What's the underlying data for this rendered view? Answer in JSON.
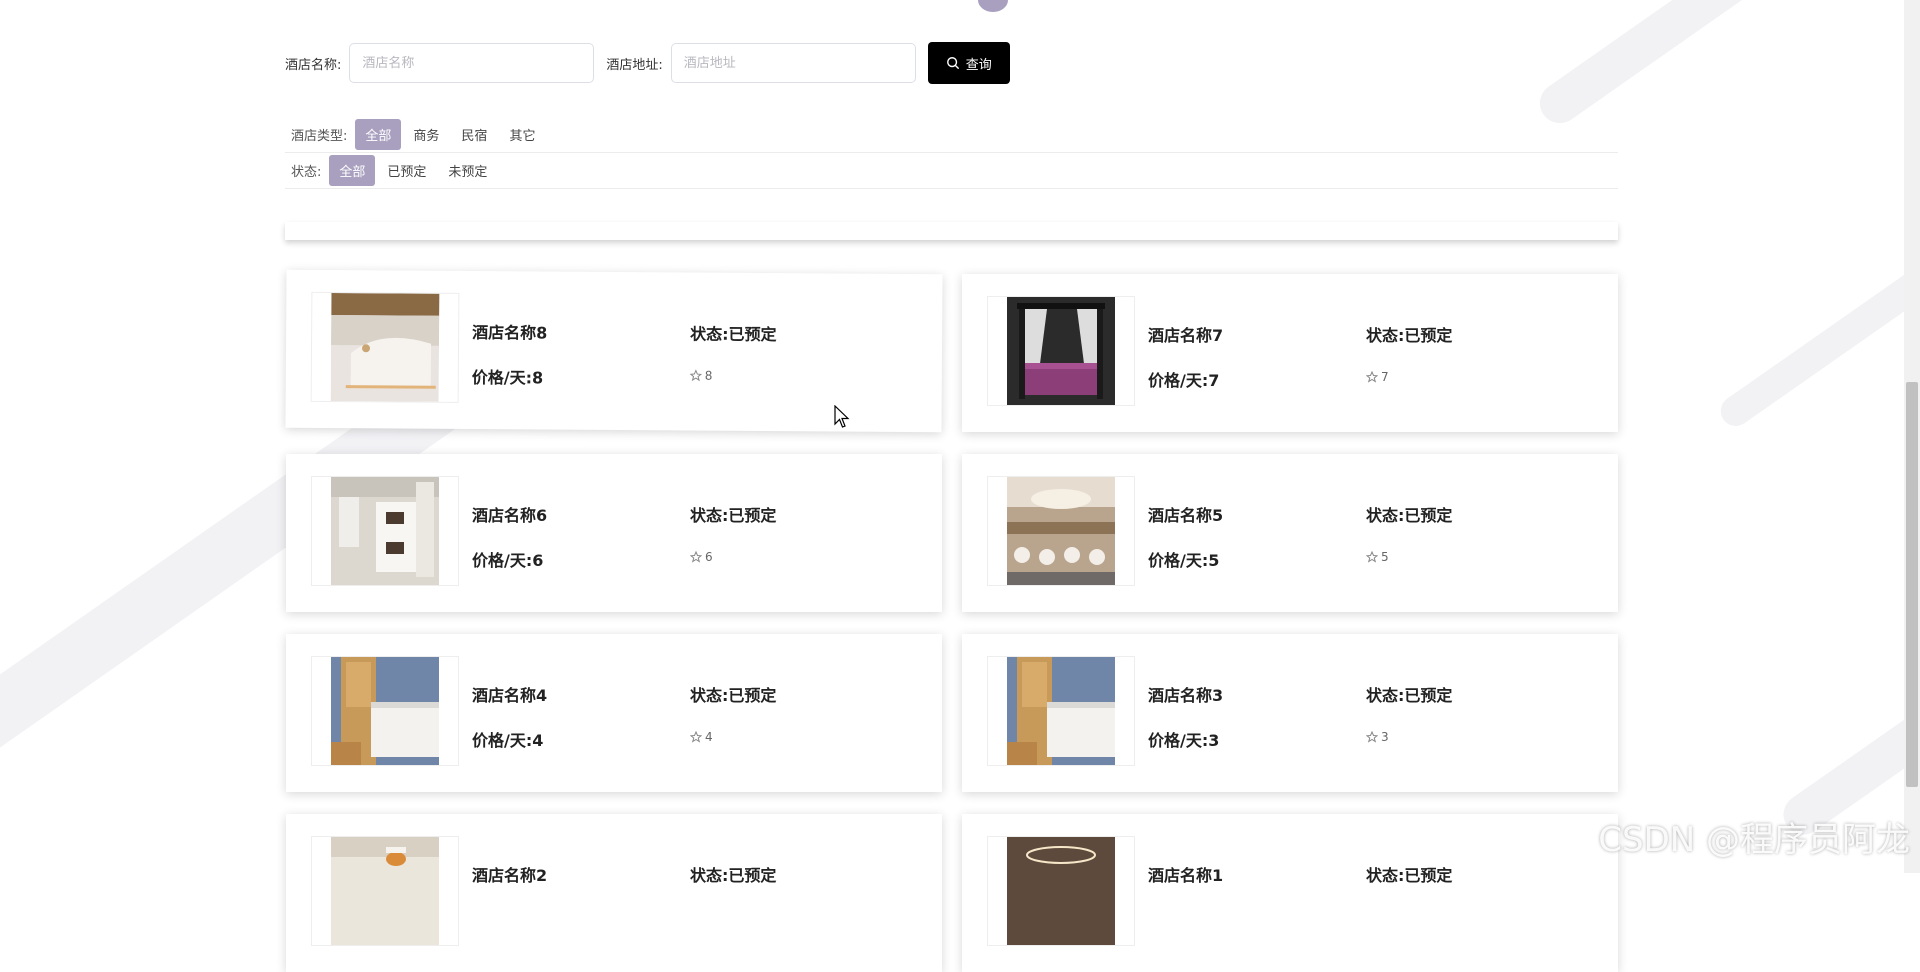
{
  "search": {
    "name_label": "酒店名称:",
    "name_placeholder": "酒店名称",
    "address_label": "酒店地址:",
    "address_placeholder": "酒店地址",
    "button_label": "查询"
  },
  "filters": {
    "type_label": "酒店类型:",
    "type_options": [
      "全部",
      "商务",
      "民宿",
      "其它"
    ],
    "type_selected": "全部",
    "status_label": "状态:",
    "status_options": [
      "全部",
      "已预定",
      "未预定"
    ],
    "status_selected": "全部"
  },
  "hotels": [
    {
      "name": "酒店名称8",
      "price": "价格/天:8",
      "status": "状态:已预定",
      "rating": "8"
    },
    {
      "name": "酒店名称7",
      "price": "价格/天:7",
      "status": "状态:已预定",
      "rating": "7"
    },
    {
      "name": "酒店名称6",
      "price": "价格/天:6",
      "status": "状态:已预定",
      "rating": "6"
    },
    {
      "name": "酒店名称5",
      "price": "价格/天:5",
      "status": "状态:已预定",
      "rating": "5"
    },
    {
      "name": "酒店名称4",
      "price": "价格/天:4",
      "status": "状态:已预定",
      "rating": "4"
    },
    {
      "name": "酒店名称3",
      "price": "价格/天:3",
      "status": "状态:已预定",
      "rating": "3"
    },
    {
      "name": "酒店名称2",
      "price": "",
      "status": "状态:已预定",
      "rating": ""
    },
    {
      "name": "酒店名称1",
      "price": "",
      "status": "状态:已预定",
      "rating": ""
    }
  ],
  "icons": {
    "search": "search-icon",
    "rating": "star-outline-icon",
    "cursor": "mouse-cursor-icon"
  },
  "colors": {
    "accent": "#a99fbf",
    "button_bg": "#000000"
  },
  "watermark": "CSDN @程序员阿龙"
}
